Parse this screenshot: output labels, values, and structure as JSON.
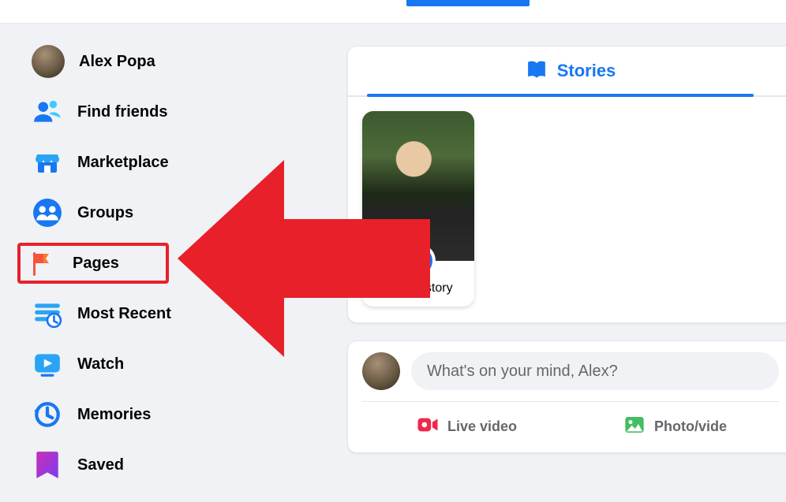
{
  "sidebar": {
    "items": [
      {
        "label": "Alex Popa"
      },
      {
        "label": "Find friends"
      },
      {
        "label": "Marketplace"
      },
      {
        "label": "Groups"
      },
      {
        "label": "Pages"
      },
      {
        "label": "Most Recent"
      },
      {
        "label": "Watch"
      },
      {
        "label": "Memories"
      },
      {
        "label": "Saved"
      }
    ]
  },
  "stories": {
    "tab_title": "Stories",
    "create_label": "Create story"
  },
  "composer": {
    "placeholder": "What's on your mind, Alex?",
    "live_label": "Live video",
    "photo_label": "Photo/vide"
  },
  "colors": {
    "accent": "#1877f2",
    "highlight": "#e8202a"
  }
}
